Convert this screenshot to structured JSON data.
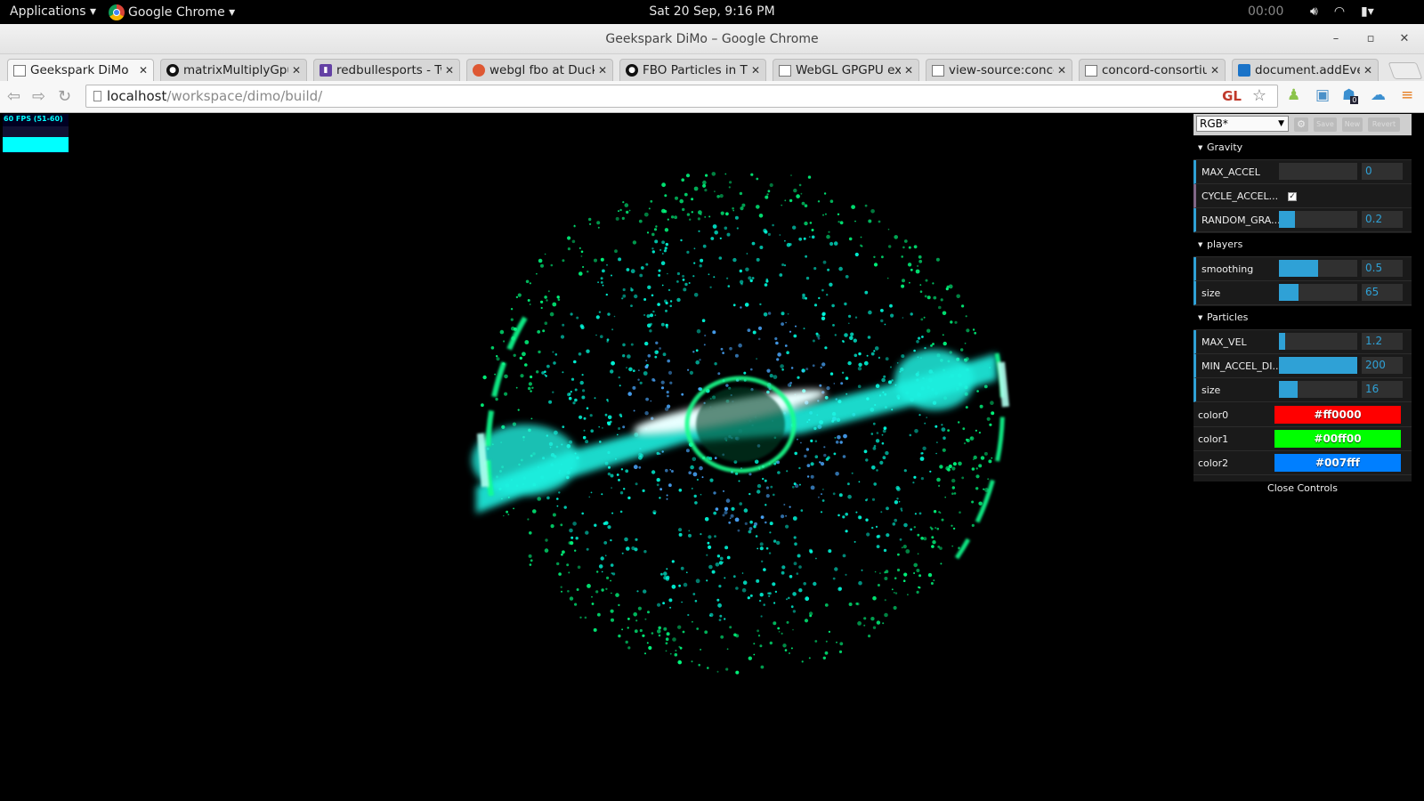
{
  "topbar": {
    "activities": "Applications ▾",
    "app_menu": "Google Chrome ▾",
    "clock": "Sat 20 Sep,  9:16 PM",
    "timer": "00:00",
    "tray": [
      "volume-icon",
      "wifi-icon",
      "battery-icon"
    ]
  },
  "window": {
    "title": "Geekspark DiMo – Google Chrome",
    "minimize": "–",
    "maximize": "▫",
    "close": "✕"
  },
  "tabs": [
    {
      "title": "Geekspark DiMo",
      "favicon": "page-icon",
      "active": true
    },
    {
      "title": "matrixMultiplyGpu.",
      "favicon": "github-icon",
      "active": false
    },
    {
      "title": "redbullesports - Tw",
      "favicon": "twitch-icon",
      "active": false
    },
    {
      "title": "webgl fbo at Duckl",
      "favicon": "duckduckgo-icon",
      "active": false
    },
    {
      "title": "FBO Particles in Th",
      "favicon": "github-icon",
      "active": false
    },
    {
      "title": "WebGL GPGPU exp",
      "favicon": "page-icon",
      "active": false
    },
    {
      "title": "view-source:conco",
      "favicon": "page-icon",
      "active": false
    },
    {
      "title": "concord-consortiun",
      "favicon": "page-icon",
      "active": false
    },
    {
      "title": "document.addEven",
      "favicon": "docs-icon",
      "active": false
    }
  ],
  "toolbar": {
    "url_host": "localhost",
    "url_path": "/workspace/dimo/build/",
    "gl_extension": "GL",
    "extension_badge": "0"
  },
  "fps": {
    "label": "60 FPS (51-60)",
    "level": 0.6
  },
  "gui": {
    "preset": "RGB*",
    "save": "Save",
    "new": "New",
    "revert": "Revert",
    "folders": {
      "gravity": "Gravity",
      "players": "players",
      "particles": "Particles"
    },
    "gravity": {
      "max_accel": {
        "label": "MAX_ACCEL",
        "value": "0",
        "fraction": 0.0
      },
      "cycle_accel": {
        "label": "CYCLE_ACCEL...",
        "checked": true
      },
      "random_gra": {
        "label": "RANDOM_GRA...",
        "value": "0.2",
        "fraction": 0.2
      }
    },
    "players": {
      "smoothing": {
        "label": "smoothing",
        "value": "0.5",
        "fraction": 0.5
      },
      "size": {
        "label": "size",
        "value": "65",
        "fraction": 0.25
      }
    },
    "particles": {
      "max_vel": {
        "label": "MAX_VEL",
        "value": "1.2",
        "fraction": 0.08
      },
      "min_accel": {
        "label": "MIN_ACCEL_DI...",
        "value": "200",
        "fraction": 1.0
      },
      "size": {
        "label": "size",
        "value": "16",
        "fraction": 0.24
      },
      "color0": {
        "label": "color0",
        "value": "#ff0000"
      },
      "color1": {
        "label": "color1",
        "value": "#00ff00"
      },
      "color2": {
        "label": "color2",
        "value": "#007fff"
      }
    },
    "close_controls": "Close Controls"
  },
  "colors": {
    "accent": "#2fa1d6",
    "particle_cyan": "#00ffe0",
    "particle_green": "#00ff80",
    "particle_blue": "#4aa8ff"
  }
}
